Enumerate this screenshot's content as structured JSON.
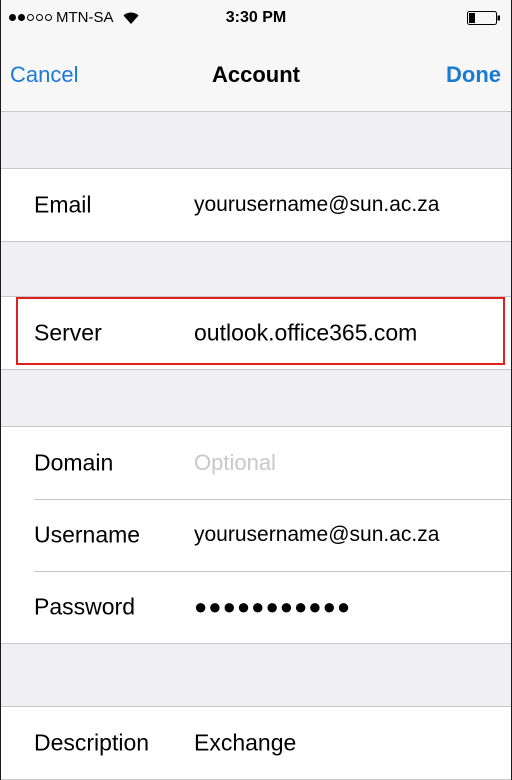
{
  "status_bar": {
    "signal_bars": 2,
    "signal_total": 5,
    "carrier": "MTN-SA",
    "wifi_icon": "wifi-icon",
    "time": "3:30 PM",
    "battery_icon": "battery-icon",
    "battery_level": 0.2
  },
  "nav": {
    "cancel_label": "Cancel",
    "title": "Account",
    "done_label": "Done"
  },
  "fields": {
    "email": {
      "label": "Email",
      "value": "yourusername@sun.ac.za"
    },
    "server": {
      "label": "Server",
      "value": "outlook.office365.com"
    },
    "domain": {
      "label": "Domain",
      "placeholder": "Optional"
    },
    "username": {
      "label": "Username",
      "value": "yourusername@sun.ac.za"
    },
    "password": {
      "label": "Password",
      "value": "●●●●●●●●●●●"
    },
    "description": {
      "label": "Description",
      "value": "Exchange"
    }
  },
  "colors": {
    "accent": "#1a7ad4",
    "highlight": "#e0201f",
    "background": "#efeff4"
  }
}
